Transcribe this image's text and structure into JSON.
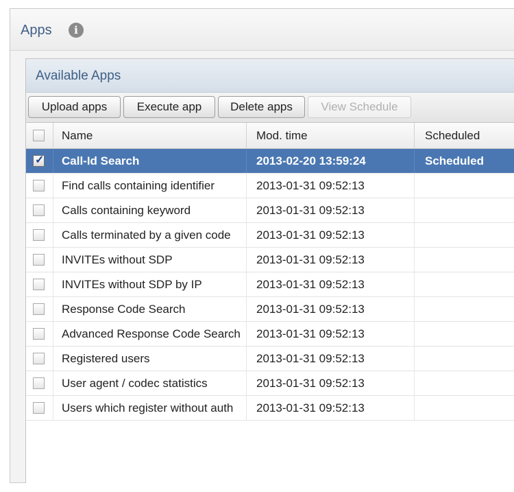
{
  "panel": {
    "title": "Apps",
    "info_icon": "info-icon"
  },
  "inner": {
    "title": "Available Apps"
  },
  "toolbar": {
    "upload": "Upload apps",
    "execute": "Execute app",
    "delete": "Delete apps",
    "schedule": "View Schedule"
  },
  "table": {
    "columns": {
      "name": "Name",
      "mod": "Mod. time",
      "sched": "Scheduled"
    },
    "rows": [
      {
        "name": "Call-Id Search",
        "mod": "2013-02-20 13:59:24",
        "sched": "Scheduled",
        "checked": true,
        "selected": true
      },
      {
        "name": "Find calls containing identifier",
        "mod": "2013-01-31 09:52:13",
        "sched": "",
        "checked": false,
        "selected": false
      },
      {
        "name": "Calls containing keyword",
        "mod": "2013-01-31 09:52:13",
        "sched": "",
        "checked": false,
        "selected": false
      },
      {
        "name": "Calls terminated by a given code",
        "mod": "2013-01-31 09:52:13",
        "sched": "",
        "checked": false,
        "selected": false
      },
      {
        "name": "INVITEs without SDP",
        "mod": "2013-01-31 09:52:13",
        "sched": "",
        "checked": false,
        "selected": false
      },
      {
        "name": "INVITEs without SDP by IP",
        "mod": "2013-01-31 09:52:13",
        "sched": "",
        "checked": false,
        "selected": false
      },
      {
        "name": "Response Code Search",
        "mod": "2013-01-31 09:52:13",
        "sched": "",
        "checked": false,
        "selected": false
      },
      {
        "name": "Advanced Response Code Search",
        "mod": "2013-01-31 09:52:13",
        "sched": "",
        "checked": false,
        "selected": false
      },
      {
        "name": "Registered users",
        "mod": "2013-01-31 09:52:13",
        "sched": "",
        "checked": false,
        "selected": false
      },
      {
        "name": "User agent / codec statistics",
        "mod": "2013-01-31 09:52:13",
        "sched": "",
        "checked": false,
        "selected": false
      },
      {
        "name": "Users which register without auth",
        "mod": "2013-01-31 09:52:13",
        "sched": "",
        "checked": false,
        "selected": false
      }
    ]
  }
}
